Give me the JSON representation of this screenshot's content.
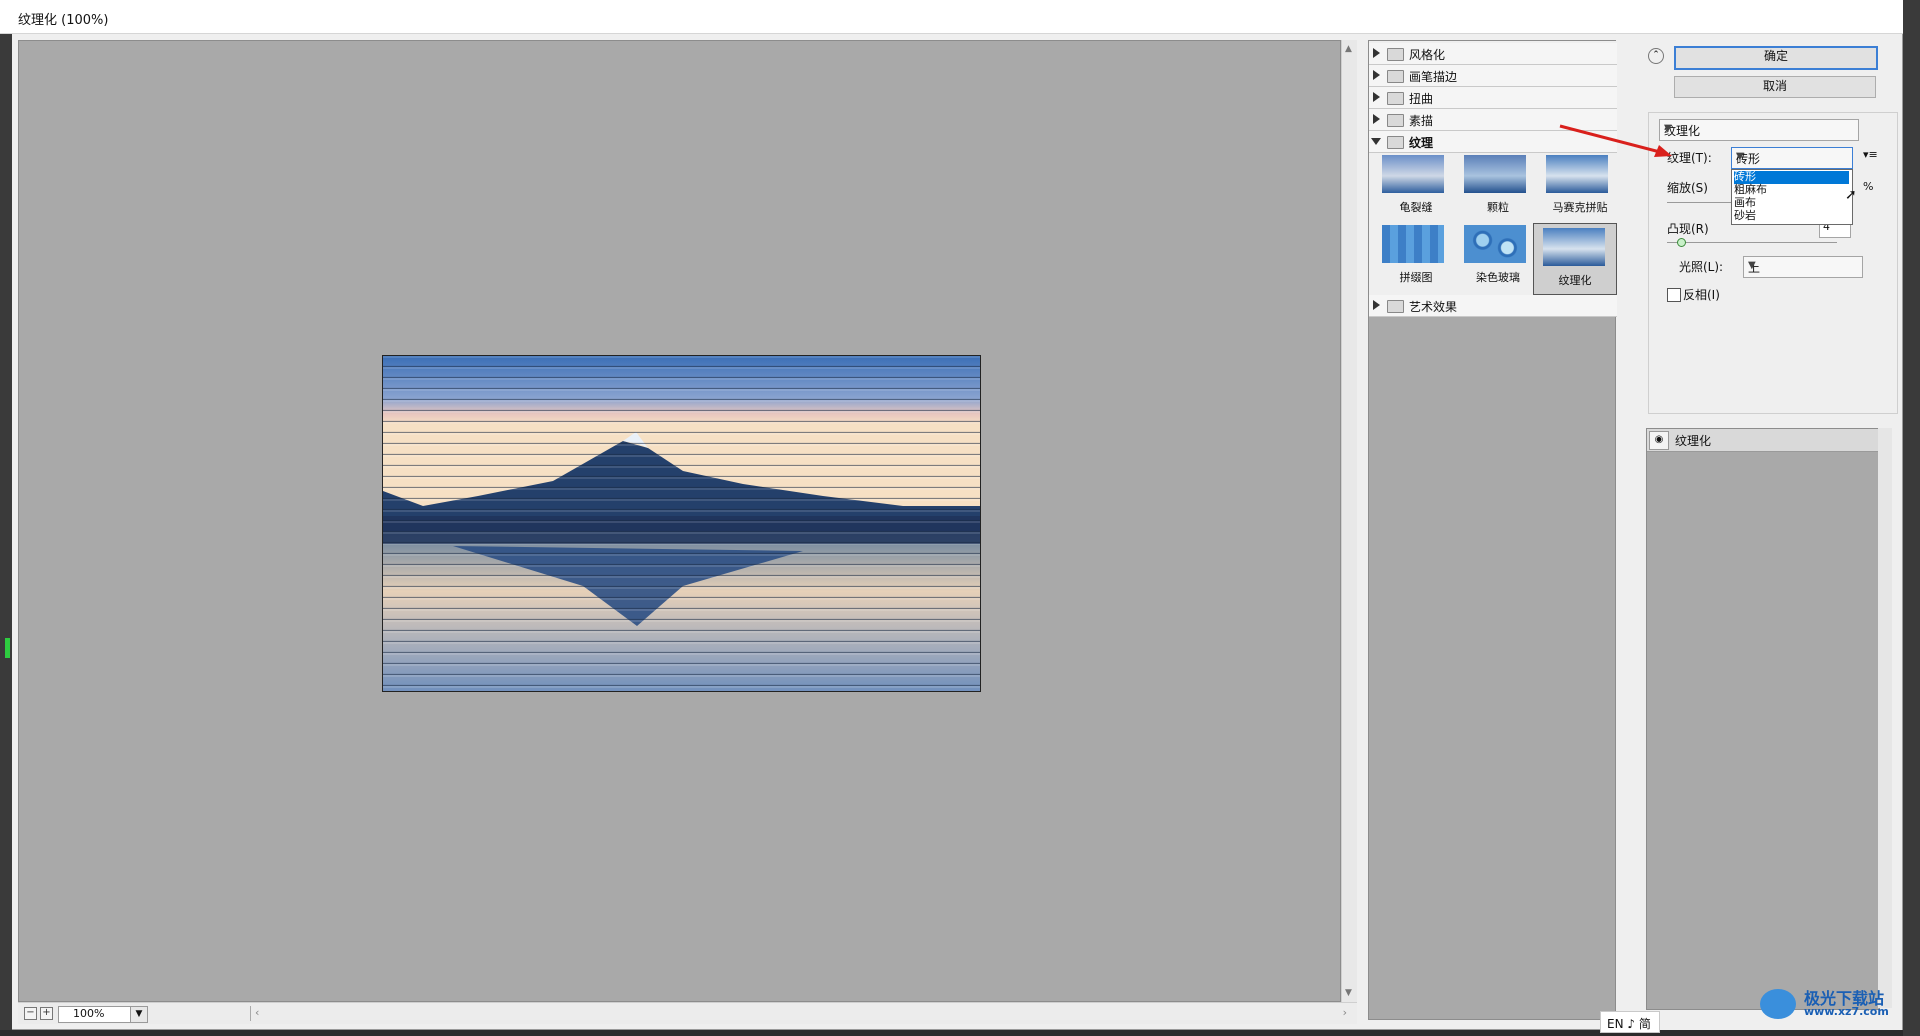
{
  "window": {
    "title": "纹理化 (100%)"
  },
  "preview": {
    "zoom": "100%",
    "zoom_out": "−",
    "zoom_in": "+"
  },
  "gallery": {
    "categories_top": [
      "风格化",
      "画笔描边",
      "扭曲",
      "素描"
    ],
    "open_category": "纹理",
    "thumbnails": [
      {
        "label": "龟裂缝"
      },
      {
        "label": "颗粒"
      },
      {
        "label": "马赛克拼贴"
      },
      {
        "label": "拼缀图"
      },
      {
        "label": "染色玻璃"
      },
      {
        "label": "纹理化",
        "selected": true
      }
    ],
    "categories_bottom": [
      "艺术效果"
    ]
  },
  "buttons": {
    "ok": "确定",
    "cancel": "取消"
  },
  "settings": {
    "filter_select": "纹理化",
    "texture_label": "纹理(T):",
    "texture_value": "砖形",
    "texture_options": [
      "砖形",
      "粗麻布",
      "画布",
      "砂岩"
    ],
    "scale_label": "缩放(S)",
    "scale_unit": "%",
    "relief_label": "凸现(R)",
    "relief_value": "4",
    "light_label": "光照(L):",
    "light_value": "上",
    "invert_label": "反相(I)",
    "invert_checked": false,
    "relief_level": 0.08
  },
  "layers": {
    "item": "纹理化"
  },
  "ime": {
    "text": "EN ♪ 简"
  },
  "watermark": {
    "name": "极光下载站",
    "site": "www.xz7.com"
  }
}
